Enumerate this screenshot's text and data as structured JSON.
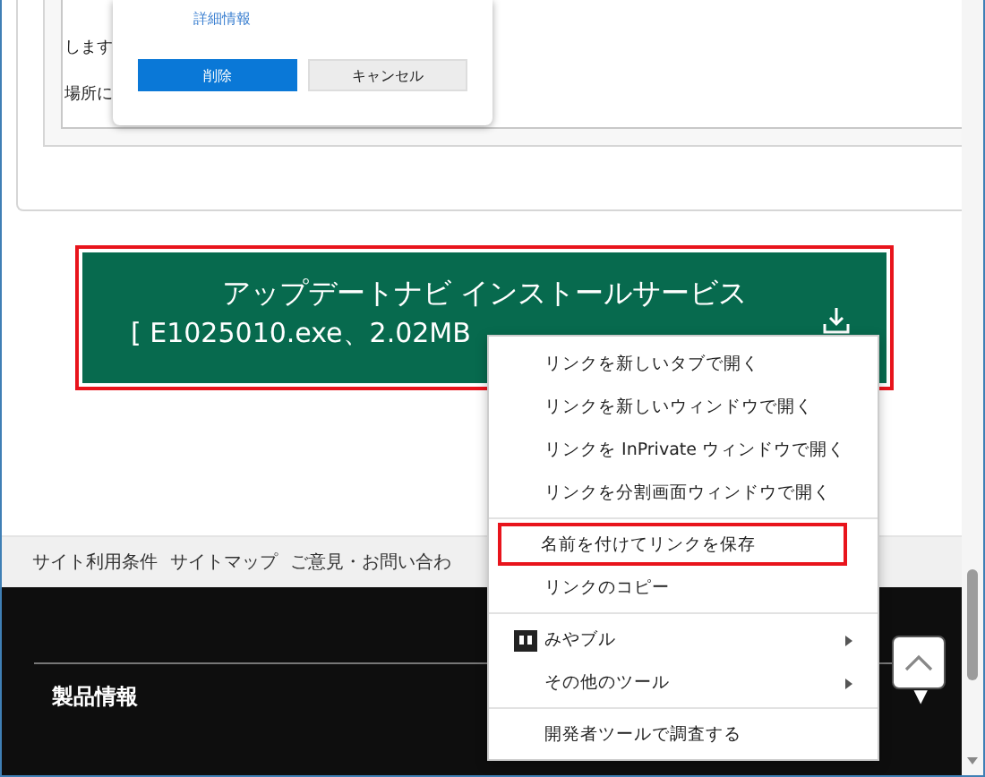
{
  "screenshot_inset": {
    "doc_lines": [
      "します",
      "場所に"
    ],
    "dialog": {
      "link": "詳細情報",
      "buttons": [
        {
          "label": "削除",
          "kind": "primary"
        },
        {
          "label": "キャンセル",
          "kind": "secondary"
        }
      ]
    }
  },
  "download_button": {
    "title": "アップデートナビ インストールサービス",
    "file_info": "[ E1025010.exe、2.02MB",
    "highlighted": true
  },
  "footer_links": [
    "サイト利用条件",
    "サイトマップ",
    "ご意見・お問い合わ"
  ],
  "footer": {
    "heading": "製品情報",
    "expand_glyph": "▼"
  },
  "context_menu": {
    "groups": [
      [
        {
          "label": "リンクを新しいタブで開く",
          "highlighted": false,
          "submenu": false
        },
        {
          "label": "リンクを新しいウィンドウで開く",
          "highlighted": false,
          "submenu": false
        },
        {
          "label": "リンクを InPrivate ウィンドウで開く",
          "highlighted": false,
          "submenu": false
        },
        {
          "label": "リンクを分割画面ウィンドウで開く",
          "highlighted": false,
          "submenu": false
        }
      ],
      [
        {
          "label": "名前を付けてリンクを保存",
          "highlighted": true,
          "submenu": false
        },
        {
          "label": "リンクのコピー",
          "highlighted": false,
          "submenu": false
        }
      ],
      [
        {
          "label": "みやブル",
          "highlighted": false,
          "submenu": true,
          "icon": true
        },
        {
          "label": "その他のツール",
          "highlighted": false,
          "submenu": true
        }
      ],
      [
        {
          "label": "開発者ツールで調査する",
          "highlighted": false,
          "submenu": false
        }
      ]
    ]
  }
}
